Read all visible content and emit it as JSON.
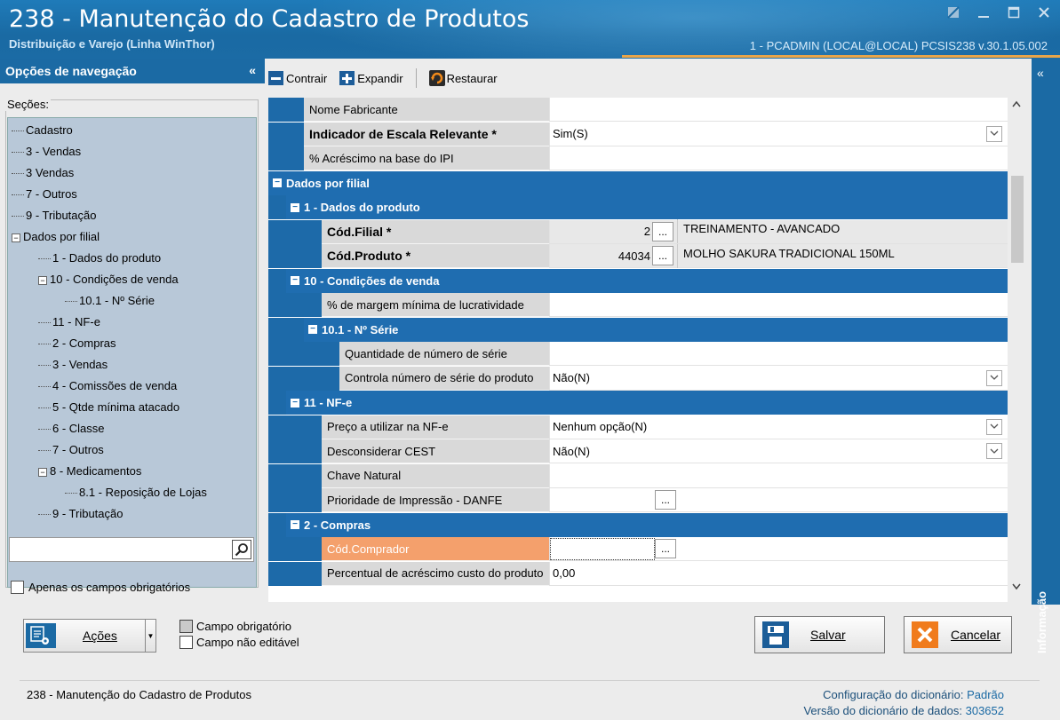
{
  "window": {
    "title": "238 - Manutenção do Cadastro de Produtos",
    "subtitle": "Distribuição e Varejo (Linha WinThor)",
    "user_info": "1 - PCADMIN (LOCAL@LOCAL)   PCSIS238  v.30.1.05.002",
    "buttons": [
      "restore-icon",
      "minimize-icon",
      "maximize-icon",
      "close-icon"
    ]
  },
  "nav": {
    "header": "Opções de navegação",
    "collapse": "«",
    "sections_label": "Seções:",
    "tree": [
      {
        "label": "Cadastro",
        "level": 0
      },
      {
        "label": "3 - Vendas",
        "level": 0
      },
      {
        "label": "3 Vendas",
        "level": 0
      },
      {
        "label": "7 - Outros",
        "level": 0
      },
      {
        "label": "9 - Tributação",
        "level": 0
      },
      {
        "label": "Dados por filial",
        "level": 0,
        "expand": "minus"
      },
      {
        "label": "1 - Dados do produto",
        "level": 1
      },
      {
        "label": "10 - Condições de venda",
        "level": 1,
        "expand": "minus"
      },
      {
        "label": "10.1 - Nº Série",
        "level": 2
      },
      {
        "label": "11 - NF-e",
        "level": 1
      },
      {
        "label": "2 - Compras",
        "level": 1
      },
      {
        "label": "3 - Vendas",
        "level": 1
      },
      {
        "label": "4 - Comissões de venda",
        "level": 1
      },
      {
        "label": "5 - Qtde mínima atacado",
        "level": 1
      },
      {
        "label": "6 - Classe",
        "level": 1
      },
      {
        "label": "7 - Outros",
        "level": 1
      },
      {
        "label": "8 - Medicamentos",
        "level": 1,
        "expand": "minus"
      },
      {
        "label": "8.1 -  Reposição de Lojas",
        "level": 2
      },
      {
        "label": "9 - Tributação",
        "level": 1
      }
    ],
    "search_value": "",
    "only_required": "Apenas os campos obrigatórios"
  },
  "toolbar": {
    "collapse": "Contrair",
    "expand": "Expandir",
    "restore": "Restaurar"
  },
  "grid": {
    "rows": [
      {
        "type": "field",
        "indent": 1,
        "label": "Nome Fabricante",
        "value": ""
      },
      {
        "type": "field",
        "indent": 1,
        "label": "Indicador de Escala Relevante *",
        "value": "Sim(S)",
        "bold": true,
        "dropdown": true
      },
      {
        "type": "field",
        "indent": 1,
        "label": "% Acréscimo na base do IPI",
        "value": ""
      },
      {
        "type": "cat",
        "indent": 0,
        "label": "Dados por filial"
      },
      {
        "type": "cat",
        "indent": 1,
        "label": "1 - Dados do produto"
      },
      {
        "type": "keyfield",
        "indent": 2,
        "label": "Cód.Filial *",
        "code": "2",
        "desc": "TREINAMENTO - AVANCADO"
      },
      {
        "type": "keyfield",
        "indent": 2,
        "label": "Cód.Produto *",
        "code": "44034",
        "desc": "MOLHO SAKURA TRADICIONAL 150ML"
      },
      {
        "type": "cat",
        "indent": 1,
        "label": "10 - Condições de venda"
      },
      {
        "type": "field",
        "indent": 2,
        "label": "% de margem mínima de lucratividade",
        "value": ""
      },
      {
        "type": "cat",
        "indent": 2,
        "label": "10.1 - Nº Série"
      },
      {
        "type": "field",
        "indent": 3,
        "label": "Quantidade de número de série",
        "value": ""
      },
      {
        "type": "field",
        "indent": 3,
        "label": "Controla número de série do produto",
        "value": "Não(N)",
        "dropdown": true
      },
      {
        "type": "cat",
        "indent": 1,
        "label": "11 - NF-e"
      },
      {
        "type": "field",
        "indent": 2,
        "label": "Preço a utilizar na NF-e",
        "value": "Nenhum opção(N)",
        "dropdown": true
      },
      {
        "type": "field",
        "indent": 2,
        "label": "Desconsiderar CEST",
        "value": "Não(N)",
        "dropdown": true
      },
      {
        "type": "field",
        "indent": 2,
        "label": "Chave Natural",
        "value": ""
      },
      {
        "type": "lookup",
        "indent": 2,
        "label": "Prioridade de Impressão - DANFE",
        "value": ""
      },
      {
        "type": "cat",
        "indent": 1,
        "label": "2 - Compras"
      },
      {
        "type": "lookup",
        "indent": 2,
        "label": "Cód.Comprador",
        "value": "",
        "active": true
      },
      {
        "type": "field",
        "indent": 2,
        "label": "Percentual de acréscimo custo do produto",
        "value": "0,00"
      }
    ],
    "ellipsis": "..."
  },
  "info_panel": {
    "label": "Informação",
    "collapse": "«"
  },
  "bottom": {
    "actions": "Ações",
    "legend_required": "Campo obrigatório",
    "legend_readonly": "Campo não editável",
    "save": "Salvar",
    "cancel": "Cancelar"
  },
  "status": {
    "left": "238 - Manutenção do Cadastro de Produtos",
    "dict_config_label": "Configuração do dicionário:",
    "dict_config_value": "Padrão",
    "dict_version_label": "Versão do dicionário de dados:",
    "dict_version_value": "303652"
  },
  "colors": {
    "brand": "#1b6aa4",
    "category": "#1f6db0",
    "active_field": "#f4a06c",
    "accent_line": "#e8a54a"
  }
}
